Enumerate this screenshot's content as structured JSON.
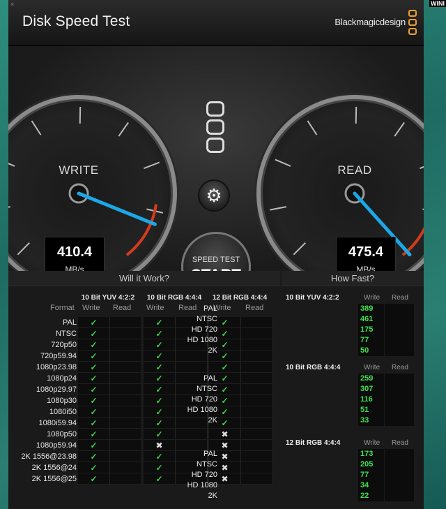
{
  "desktop_label": "WINI",
  "window": {
    "title": "Disk Speed Test",
    "brand": "Blackmagicdesign",
    "close_glyph": "×"
  },
  "write_gauge": {
    "label": "WRITE",
    "value": "410.4",
    "unit": "MB/s"
  },
  "read_gauge": {
    "label": "READ",
    "value": "475.4",
    "unit": "MB/s"
  },
  "start_button": {
    "small": "SPEED TEST",
    "big": "START"
  },
  "gear_glyph": "⚙",
  "will_it_work": {
    "heading": "Will it Work?",
    "format_label": "Format",
    "groups": [
      "10 Bit YUV 4:2:2",
      "10 Bit RGB 4:4:4",
      "12 Bit RGB 4:4:4"
    ],
    "write_label": "Write",
    "read_label": "Read",
    "rows": [
      {
        "name": "PAL",
        "w": [
          "ok",
          "ok",
          "ok"
        ]
      },
      {
        "name": "NTSC",
        "w": [
          "ok",
          "ok",
          "ok"
        ]
      },
      {
        "name": "720p50",
        "w": [
          "ok",
          "ok",
          "ok"
        ]
      },
      {
        "name": "720p59.94",
        "w": [
          "ok",
          "ok",
          "ok"
        ]
      },
      {
        "name": "1080p23.98",
        "w": [
          "ok",
          "ok",
          "ok"
        ]
      },
      {
        "name": "1080p24",
        "w": [
          "ok",
          "ok",
          "ok"
        ]
      },
      {
        "name": "1080p29.97",
        "w": [
          "ok",
          "ok",
          "ok"
        ]
      },
      {
        "name": "1080p30",
        "w": [
          "ok",
          "ok",
          "ok"
        ]
      },
      {
        "name": "1080i50",
        "w": [
          "ok",
          "ok",
          "ok"
        ]
      },
      {
        "name": "1080i59.94",
        "w": [
          "ok",
          "ok",
          "ok"
        ]
      },
      {
        "name": "1080p50",
        "w": [
          "ok",
          "ok",
          "no"
        ]
      },
      {
        "name": "1080p59.94",
        "w": [
          "ok",
          "no",
          "no"
        ]
      },
      {
        "name": "2K 1556@23.98",
        "w": [
          "ok",
          "ok",
          "no"
        ]
      },
      {
        "name": "2K 1556@24",
        "w": [
          "ok",
          "ok",
          "no"
        ]
      },
      {
        "name": "2K 1556@25",
        "w": [
          "ok",
          "ok",
          "no"
        ]
      }
    ]
  },
  "how_fast": {
    "heading": "How Fast?",
    "write_label": "Write",
    "read_label": "Read",
    "blocks": [
      {
        "title": "10 Bit YUV 4:2:2",
        "rows": [
          {
            "name": "PAL",
            "value": "389"
          },
          {
            "name": "NTSC",
            "value": "461"
          },
          {
            "name": "HD 720",
            "value": "175"
          },
          {
            "name": "HD 1080",
            "value": "77"
          },
          {
            "name": "2K",
            "value": "50"
          }
        ]
      },
      {
        "title": "10 Bit RGB 4:4:4",
        "rows": [
          {
            "name": "PAL",
            "value": "259"
          },
          {
            "name": "NTSC",
            "value": "307"
          },
          {
            "name": "HD 720",
            "value": "116"
          },
          {
            "name": "HD 1080",
            "value": "51"
          },
          {
            "name": "2K",
            "value": "33"
          }
        ]
      },
      {
        "title": "12 Bit RGB 4:4:4",
        "rows": [
          {
            "name": "PAL",
            "value": "173"
          },
          {
            "name": "NTSC",
            "value": "205"
          },
          {
            "name": "HD 720",
            "value": "77"
          },
          {
            "name": "HD 1080",
            "value": "34"
          },
          {
            "name": "2K",
            "value": "22"
          }
        ]
      }
    ]
  },
  "colors": {
    "ok": "#3dd34a",
    "value_green": "#42e04f",
    "needle": "#1aa9e8",
    "redzone": "#d63a1e"
  }
}
